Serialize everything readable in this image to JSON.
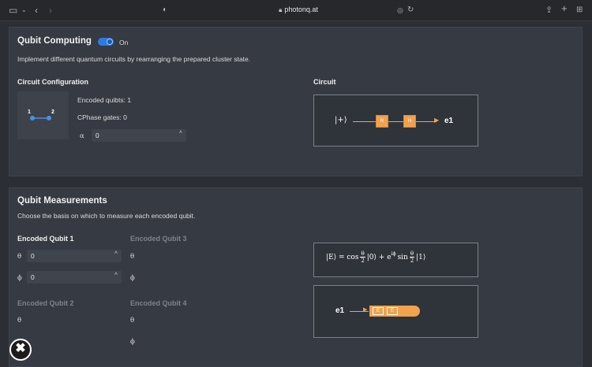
{
  "browser": {
    "url": "photonq.at"
  },
  "computing": {
    "title": "Qubit Computing",
    "toggle_label": "On",
    "description": "Implement different quantum circuits by rearranging the prepared cluster state.",
    "config_title": "Circuit Configuration",
    "graph_nodes": [
      "1",
      "2"
    ],
    "encoded_qubits": "Encoded quibts: 1",
    "cphase_gates": "CPhase gates: 0",
    "alpha_label": "α",
    "alpha_value": "0",
    "circuit_title": "Circuit",
    "circuit_input": "|+⟩",
    "gate1": "R",
    "gate2": "H",
    "circuit_output": "e1"
  },
  "measurements": {
    "title": "Qubit Measurements",
    "description": "Choose the basis on which to measure each encoded qubit.",
    "qubit1_title": "Encoded Qubit 1",
    "qubit2_title": "Encoded Qubit 2",
    "qubit3_title": "Encoded Qubit 3",
    "qubit4_title": "Encoded Qubit 4",
    "theta_label": "θ",
    "phi_label": "ϕ",
    "q1_theta_value": "0",
    "q1_phi_value": "0",
    "formula_lhs": "|E⟩ = cos",
    "formula_mid": "|0⟩ + e",
    "formula_exp": "iϕ",
    "formula_sin": "sin",
    "formula_end": "|1⟩",
    "frac_num": "θ",
    "frac_den": "2",
    "meas_label": "e1",
    "meas_gate1": "E",
    "meas_gate2": "E"
  },
  "colors": {
    "accent": "#2c7be5",
    "gate": "#f0a24c",
    "node": "#4a90e2"
  }
}
